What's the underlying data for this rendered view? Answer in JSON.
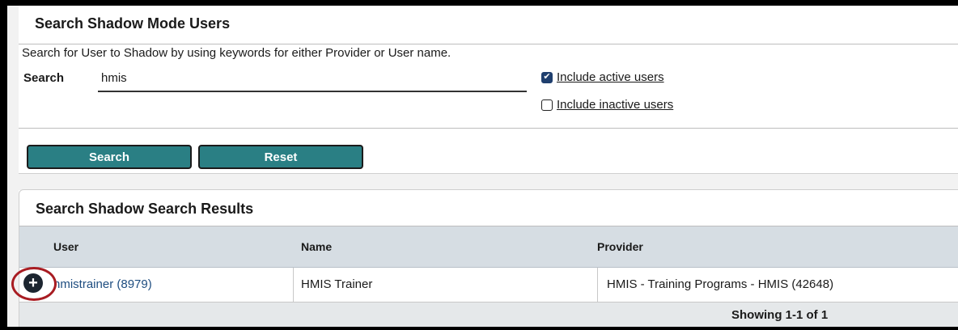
{
  "search_panel": {
    "title": "Search Shadow Mode Users",
    "instructions": "Search for User to Shadow by using keywords for either Provider or User name.",
    "search_label": "Search",
    "search_value": "hmis",
    "include_active_label": "Include active users",
    "include_active_checked": true,
    "include_inactive_label": "Include inactive users",
    "include_inactive_checked": false,
    "search_button": "Search",
    "reset_button": "Reset"
  },
  "results": {
    "title": "Search Shadow Search Results",
    "columns": [
      "User",
      "Name",
      "Provider"
    ],
    "rows": [
      {
        "user": "hmistrainer (8979)",
        "name": "HMIS Trainer",
        "provider": "HMIS - Training Programs - HMIS (42648)"
      }
    ],
    "showing": "Showing 1-1 of 1"
  },
  "icons": {
    "expand": "plus-circle-icon",
    "check": "check-icon"
  },
  "colors": {
    "button": "#2a7f84",
    "highlight_ring": "#a81c22",
    "header_bg": "#d6dde3"
  }
}
